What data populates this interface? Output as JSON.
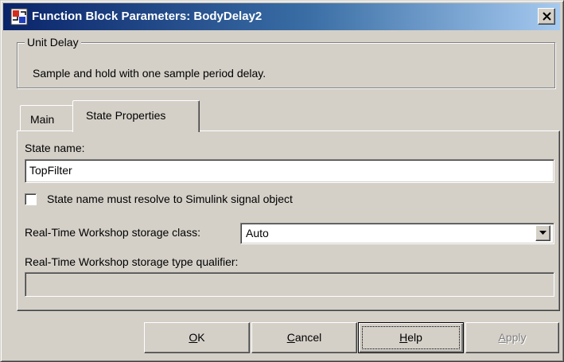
{
  "window": {
    "title": "Function Block Parameters: BodyDelay2",
    "close_glyph": "×"
  },
  "block": {
    "name": "Unit Delay",
    "description": "Sample and hold with one sample period delay."
  },
  "tabs": [
    {
      "label": "Main",
      "selected": false
    },
    {
      "label": "State Properties",
      "selected": true
    }
  ],
  "state": {
    "name_label": "State name:",
    "name_value": "TopFilter",
    "resolve_label": "State name must resolve to Simulink signal object",
    "resolve_checked": false,
    "storage_class_label": "Real-Time Workshop storage class:",
    "storage_class_value": "Auto",
    "type_qualifier_label": "Real-Time Workshop storage type qualifier:",
    "type_qualifier_value": ""
  },
  "buttons": {
    "ok": {
      "label": "OK",
      "mnemonic": "O",
      "rest": "K"
    },
    "cancel": {
      "label": "Cancel",
      "mnemonic": "C",
      "rest": "ancel"
    },
    "help": {
      "label": "Help",
      "mnemonic": "H",
      "rest": "elp"
    },
    "apply": {
      "label": "Apply",
      "mnemonic": "A",
      "rest": "pply"
    }
  },
  "colors": {
    "title_gradient_start": "#0a246a",
    "title_gradient_end": "#a6caf0",
    "face": "#d4d0c8"
  },
  "icons": [
    "simulink-block-icon",
    "close-icon",
    "dropdown-arrow-icon"
  ]
}
